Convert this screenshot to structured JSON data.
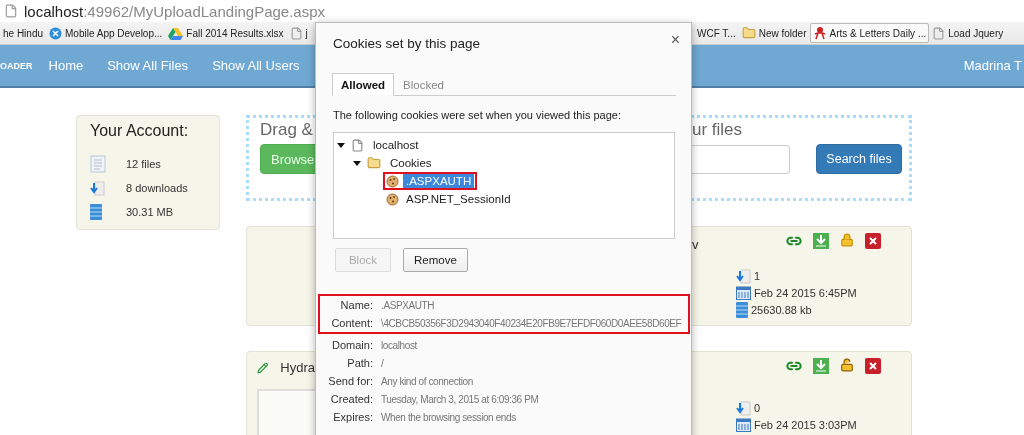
{
  "address_bar": {
    "host": "localhost",
    "path": ":49962/MyUploadLandingPage.aspx"
  },
  "bookmarks_left": [
    {
      "label": "he Hindu",
      "kind": "plain",
      "hovered": false
    },
    {
      "label": "Mobile App Develop...",
      "kind": "xbadge",
      "hovered": false
    },
    {
      "label": "Fall 2014 Results.xlsx",
      "kind": "drive",
      "hovered": false
    },
    {
      "label": "j",
      "kind": "page",
      "hovered": false
    }
  ],
  "bookmarks_right": [
    {
      "label": "WCF T...",
      "kind": "plain",
      "hovered": false
    },
    {
      "label": "New folder",
      "kind": "folder",
      "hovered": false
    },
    {
      "label": "Arts & Letters Daily ...",
      "kind": "figure",
      "hovered": true
    },
    {
      "label": "Load Jquery",
      "kind": "page",
      "hovered": false
    }
  ],
  "navbar": {
    "logo": "OADER",
    "links": [
      "Home",
      "Show All Files",
      "Show All Users"
    ],
    "user": "Madrina T"
  },
  "account": {
    "title": "Your Account:",
    "items": [
      {
        "kind": "files",
        "text": "12 files"
      },
      {
        "kind": "downloads",
        "text": "8 downloads"
      },
      {
        "kind": "storage",
        "text": "30.31 MB"
      }
    ]
  },
  "upload": {
    "heading_left": "Drag &",
    "heading_right": "ur files",
    "browse_button": "Browse",
    "search_button": "Search files"
  },
  "files": [
    {
      "title_right": "v",
      "actions": [
        {
          "kind": "link"
        },
        {
          "kind": "download"
        },
        {
          "kind": "lock",
          "locked": true
        },
        {
          "kind": "delete"
        }
      ],
      "stats": [
        {
          "kind": "downloads",
          "text": "1"
        },
        {
          "kind": "date",
          "text": "Feb 24 2015 6:45PM"
        },
        {
          "kind": "size",
          "text": "25630.88 kb"
        }
      ]
    },
    {
      "title_left": "Hydra",
      "actions": [
        {
          "kind": "link"
        },
        {
          "kind": "download"
        },
        {
          "kind": "lock",
          "locked": false
        },
        {
          "kind": "delete"
        }
      ],
      "stats": [
        {
          "kind": "downloads",
          "text": "0"
        },
        {
          "kind": "date",
          "text": "Feb 24 2015 3:03PM"
        }
      ]
    }
  ],
  "dialog": {
    "title": "Cookies set by this page",
    "close": "×",
    "tabs": [
      {
        "label": "Allowed",
        "selected": true
      },
      {
        "label": "Blocked",
        "selected": false
      }
    ],
    "intro": "The following cookies were set when you viewed this page:",
    "tree": [
      {
        "label": "localhost",
        "kind": "page",
        "selected": false,
        "expanded": true,
        "children": [
          {
            "label": "Cookies",
            "kind": "folder",
            "selected": false,
            "expanded": true,
            "children": [
              {
                "label": ".ASPXAUTH",
                "kind": "cookie",
                "selected": true,
                "highlighted": true
              },
              {
                "label": "ASP.NET_SessionId",
                "kind": "cookie",
                "selected": false,
                "highlighted": false
              }
            ]
          }
        ]
      }
    ],
    "buttons": [
      {
        "label": "Block",
        "disabled": true
      },
      {
        "label": "Remove",
        "disabled": false
      }
    ],
    "details": [
      {
        "label": "Name:",
        "value": ".ASPXAUTH",
        "highlighted": true
      },
      {
        "label": "Content:",
        "value": "\\4CBCB50356F3D2943040F40234E20FB9E7EFDF060D0AEE58D60EF",
        "highlighted": true
      },
      {
        "label": "Domain:",
        "value": "localhost",
        "highlighted": false
      },
      {
        "label": "Path:",
        "value": "/",
        "highlighted": false
      },
      {
        "label": "Send for:",
        "value": "Any kind of connection",
        "highlighted": false
      },
      {
        "label": "Created:",
        "value": "Tuesday, March 3, 2015 at 6:09:36 PM",
        "highlighted": false
      },
      {
        "label": "Expires:",
        "value": "When the browsing session ends",
        "highlighted": false
      }
    ]
  }
}
